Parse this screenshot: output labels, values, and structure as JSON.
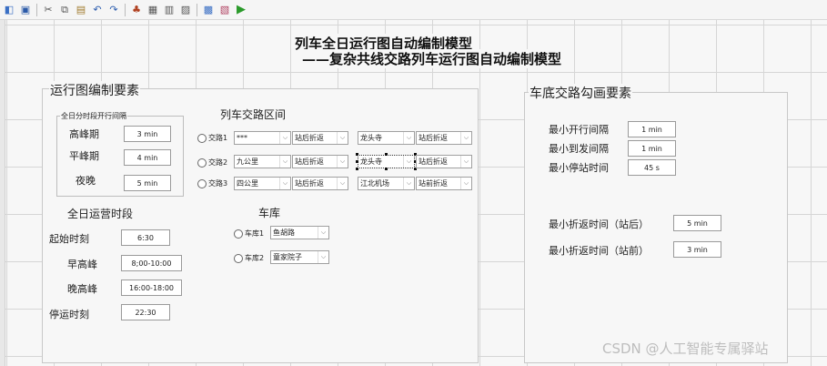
{
  "title_line1": "列车全日运行图自动编制模型",
  "title_line2": "——复杂共线交路列车运行图自动编制模型",
  "toolbar_icons": [
    "save-icon",
    "floppy-icon",
    "cut-icon",
    "copy-icon",
    "paste-icon",
    "undo-icon",
    "redo-icon",
    "tree-icon",
    "form-icon",
    "table-icon",
    "chart-icon",
    "image-icon",
    "flow-icon",
    "run-icon"
  ],
  "left_group": {
    "title": "运行图编制要素",
    "period_group": {
      "title": "全日分时段开行间隔",
      "rows": [
        {
          "label": "高峰期",
          "value": "3 min"
        },
        {
          "label": "平峰期",
          "value": "4 min"
        },
        {
          "label": "夜晚",
          "value": "5 min"
        }
      ]
    },
    "operation": {
      "title": "全日运营时段",
      "rows": [
        {
          "label": "起始时刻",
          "value": "6:30"
        },
        {
          "label": "早高峰",
          "value": "8;00-10:00"
        },
        {
          "label": "晚高峰",
          "value": "16:00-18:00"
        },
        {
          "label": "停运时刻",
          "value": "22:30"
        }
      ]
    },
    "routing": {
      "title": "列车交路区间",
      "routes": [
        {
          "label": "交路1",
          "start": "***",
          "start_turn": "站后折返",
          "end": "龙头寺",
          "end_turn": "站后折返"
        },
        {
          "label": "交路2",
          "start": "九公里",
          "start_turn": "站后折返",
          "end": "龙头寺",
          "end_turn": "站后折返"
        },
        {
          "label": "交路3",
          "start": "四公里",
          "start_turn": "站后折返",
          "end": "江北机场",
          "end_turn": "站前折返"
        }
      ]
    },
    "depot": {
      "title": "车库",
      "items": [
        {
          "label": "车库1",
          "value": "鱼胡路"
        },
        {
          "label": "车库2",
          "value": "童家院子"
        }
      ]
    }
  },
  "right_group": {
    "title": "车底交路勾画要素",
    "rows": [
      {
        "label": "最小开行间隔",
        "value": "1 min"
      },
      {
        "label": "最小到发间隔",
        "value": "1 min"
      },
      {
        "label": "最小停站时间",
        "value": "45 s"
      },
      {
        "label": "最小折返时间（站后）",
        "value": "5 min"
      },
      {
        "label": "最小折返时间（站前）",
        "value": "3 min"
      }
    ]
  },
  "watermark": "CSDN @人工智能专属驿站"
}
